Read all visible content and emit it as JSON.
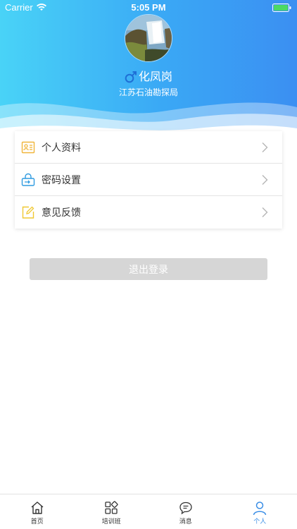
{
  "status_bar": {
    "carrier": "Carrier",
    "time": "5:05 PM"
  },
  "profile": {
    "name": "化凤岗",
    "organization": "江苏石油勘探局",
    "gender_icon": "male-symbol-icon"
  },
  "menu": [
    {
      "label": "个人资料",
      "icon": "profile-card-icon",
      "color": "#f0b53a"
    },
    {
      "label": "密码设置",
      "icon": "password-lock-icon",
      "color": "#2f9be0"
    },
    {
      "label": "意见反馈",
      "icon": "feedback-edit-icon",
      "color": "#f0c832"
    }
  ],
  "logout_label": "退出登录",
  "tabs": [
    {
      "label": "首页",
      "icon": "home-icon",
      "active": false
    },
    {
      "label": "培训班",
      "icon": "grid-icon",
      "active": false
    },
    {
      "label": "消息",
      "icon": "message-icon",
      "active": false
    },
    {
      "label": "个人",
      "icon": "person-icon",
      "active": true
    }
  ],
  "colors": {
    "header_start": "#49d3f7",
    "header_end": "#3b8ff2",
    "accent": "#3a8ee6",
    "logout_bg": "#d6d6d6"
  }
}
